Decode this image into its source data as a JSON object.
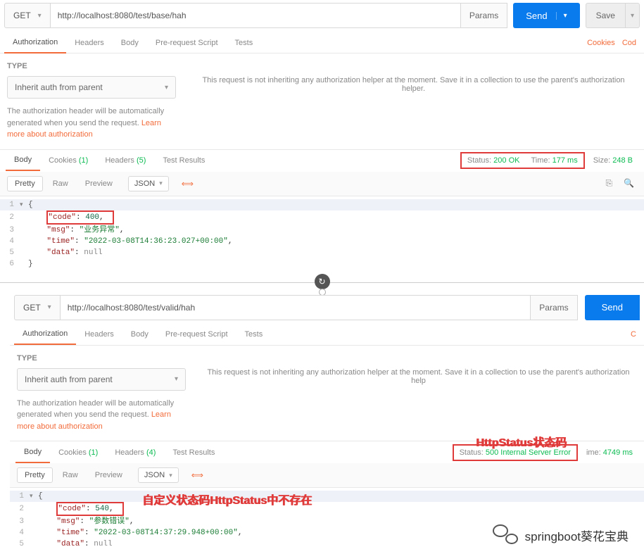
{
  "top": {
    "method": "GET",
    "url": "http://localhost:8080/test/base/hah",
    "params_btn": "Params",
    "send_btn": "Send",
    "save_btn": "Save",
    "tabs": {
      "authorization": "Authorization",
      "headers": "Headers",
      "body": "Body",
      "prerequest": "Pre-request Script",
      "tests": "Tests"
    },
    "tab_links": {
      "cookies": "Cookies",
      "code": "Cod"
    },
    "auth": {
      "type_label": "TYPE",
      "type_value": "Inherit auth from parent",
      "desc_1": "The authorization header will be automatically generated when you send the request. ",
      "desc_link": "Learn more about authorization",
      "message": "This request is not inheriting any authorization helper at the moment. Save it in a collection to use the parent's authorization helper."
    },
    "response_tabs": {
      "body": "Body",
      "cookies": "Cookies",
      "cookies_n": "(1)",
      "headers": "Headers",
      "headers_n": "(5)",
      "tests": "Test Results"
    },
    "status_label": "Status:",
    "status_value": "200 OK",
    "time_label": "Time:",
    "time_value": "177 ms",
    "size_label": "Size:",
    "size_value": "248 B",
    "body_controls": {
      "pretty": "Pretty",
      "raw": "Raw",
      "preview": "Preview",
      "json": "JSON"
    },
    "json_body": {
      "l1": "{",
      "l2_k": "\"code\"",
      "l2_v": "400",
      "l3_k": "\"msg\"",
      "l3_v": "\"业务异常\"",
      "l4_k": "\"time\"",
      "l4_v": "\"2022-03-08T14:36:23.027+00:00\"",
      "l5_k": "\"data\"",
      "l5_v": "null",
      "l6": "}"
    }
  },
  "bottom": {
    "method": "GET",
    "url": "http://localhost:8080/test/valid/hah",
    "params_btn": "Params",
    "send_btn": "Send",
    "tabs": {
      "authorization": "Authorization",
      "headers": "Headers",
      "body": "Body",
      "prerequest": "Pre-request Script",
      "tests": "Tests"
    },
    "tab_links": {
      "code": "C"
    },
    "auth": {
      "type_label": "TYPE",
      "type_value": "Inherit auth from parent",
      "desc_1": "The authorization header will be automatically generated when you send the request. ",
      "desc_link": "Learn more about authorization",
      "message": "This request is not inheriting any authorization helper at the moment. Save it in a collection to use the parent's authorization help"
    },
    "response_tabs": {
      "body": "Body",
      "cookies": "Cookies",
      "cookies_n": "(1)",
      "headers": "Headers",
      "headers_n": "(4)",
      "tests": "Test Results"
    },
    "status_label": "Status:",
    "status_value": "500 Internal Server Error",
    "time_label": "ime:",
    "time_value": "4749 ms",
    "body_controls": {
      "pretty": "Pretty",
      "raw": "Raw",
      "preview": "Preview",
      "json": "JSON"
    },
    "json_body": {
      "l1": "{",
      "l2_k": "\"code\"",
      "l2_v": "540",
      "l3_k": "\"msg\"",
      "l3_v": "\"参数错误\"",
      "l4_k": "\"time\"",
      "l4_v": "\"2022-03-08T14:37:29.948+00:00\"",
      "l5_k": "\"data\"",
      "l5_v": "null"
    },
    "annotation_httpstatus": "HttpStatus状态码",
    "annotation_custom": "自定义状态码HttpStatus中不存在",
    "wechat_label": "springboot葵花宝典"
  }
}
